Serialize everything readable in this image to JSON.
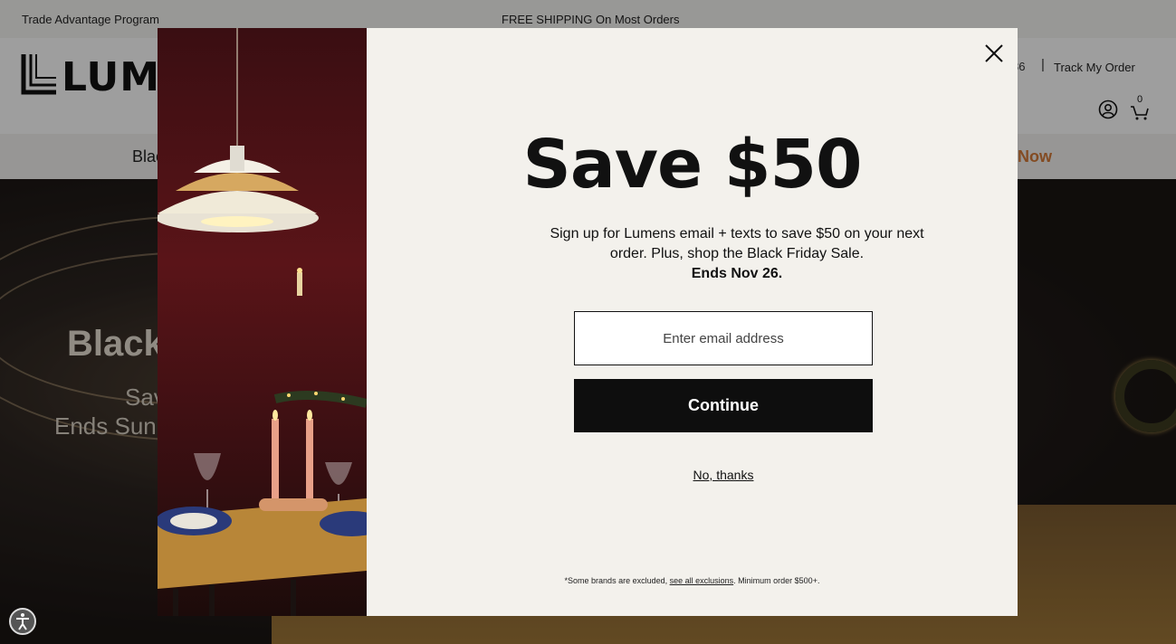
{
  "topbar": {
    "trade_program": "Trade Advantage Program",
    "shipping": "FREE SHIPPING On Most Orders"
  },
  "header": {
    "logo_text": "LUMEN",
    "phone_partial": "86",
    "separator": "|",
    "track_order": "Track My Order",
    "cart_count": "0"
  },
  "nav": {
    "left_item": "Blac",
    "right_item": "p Now"
  },
  "hero": {
    "title": "Black",
    "sub1": "Sav",
    "sub2": "Ends Sun"
  },
  "modal": {
    "title": "Save $50",
    "description": "Sign up for Lumens email + texts to save $50 on your next order. Plus, shop the Black Friday Sale.",
    "ends": "Ends Nov 26.",
    "email_placeholder": "Enter email address",
    "continue_label": "Continue",
    "no_thanks_label": "No, thanks",
    "fineprint_prefix": "*Some brands are excluded, ",
    "fineprint_link": "see all exclusions",
    "fineprint_suffix": ". Minimum order $500+."
  },
  "colors": {
    "accent_orange": "#d47a38",
    "button_black": "#0e0e0e",
    "modal_bg": "#f3f1ec"
  },
  "icons": {
    "close": "close-icon",
    "account": "account-icon",
    "cart": "cart-icon",
    "accessibility": "accessibility-icon"
  }
}
